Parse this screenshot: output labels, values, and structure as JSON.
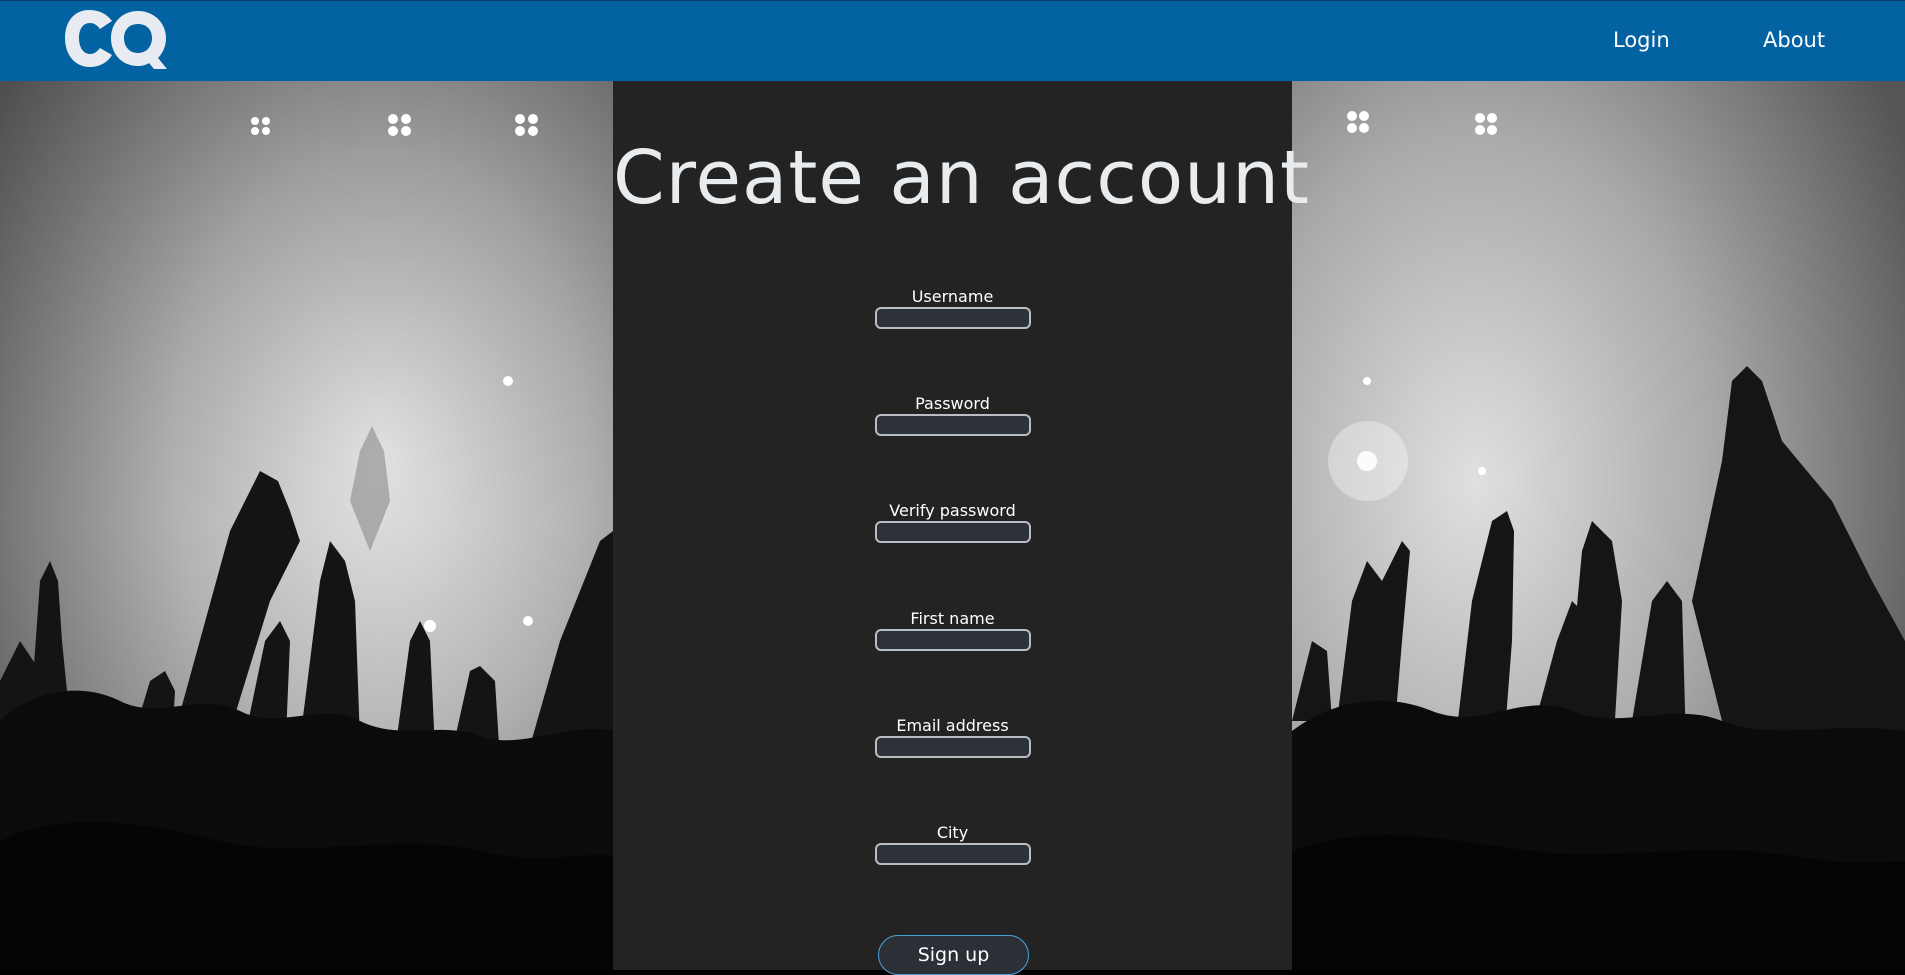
{
  "header": {
    "logo_text": "CQ",
    "nav": {
      "login_label": "Login",
      "about_label": "About"
    }
  },
  "signup_form": {
    "title": "Create an account",
    "fields": {
      "username": {
        "label": "Username",
        "value": ""
      },
      "password": {
        "label": "Password",
        "value": ""
      },
      "verify_password": {
        "label": "Verify password",
        "value": ""
      },
      "first_name": {
        "label": "First name",
        "value": ""
      },
      "email": {
        "label": "Email address",
        "value": ""
      },
      "city": {
        "label": "City",
        "value": ""
      }
    },
    "submit_label": "Sign up"
  },
  "colors": {
    "navbar": "#0262a2",
    "panel": "#232323",
    "button_border": "#4aa3df"
  }
}
